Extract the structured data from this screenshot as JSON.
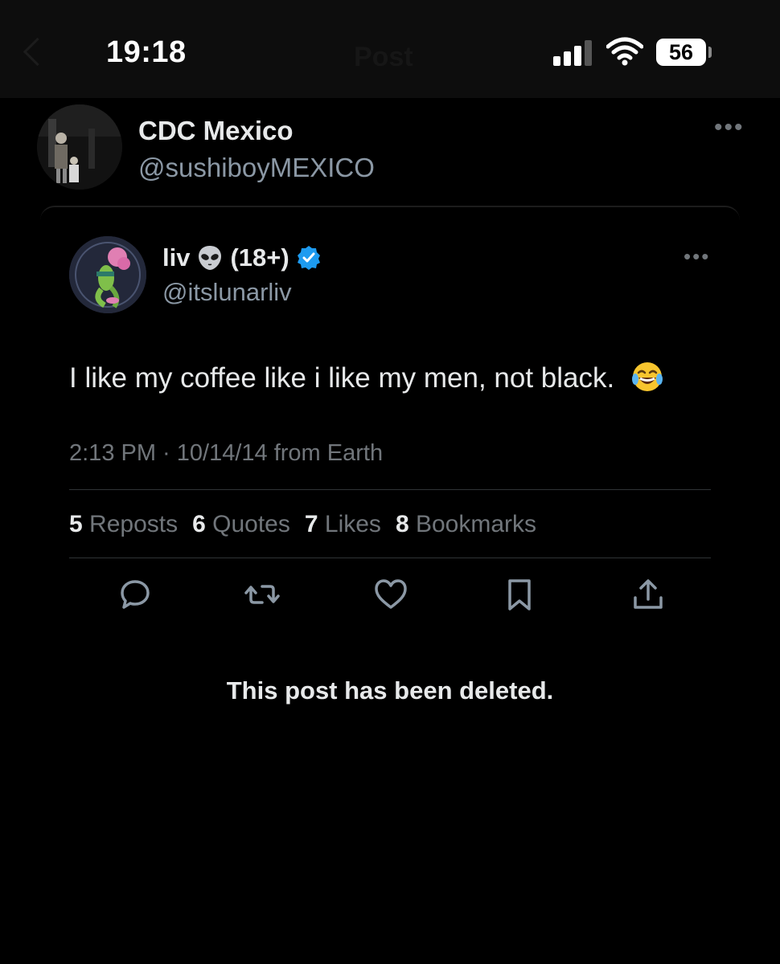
{
  "status_bar": {
    "time": "19:18",
    "battery": "56",
    "ghost_title": "Post"
  },
  "repost": {
    "display_name": "CDC Mexico",
    "handle": "@sushiboyMEXICO"
  },
  "quoted_post": {
    "display_name": "liv",
    "name_suffix": "(18+)",
    "handle": "@itslunarliv",
    "text": "I like my coffee like i like my men, not black.",
    "timestamp": "2:13 PM · 10/14/14 from Earth",
    "stats": {
      "reposts_count": "5",
      "reposts_label": "Reposts",
      "quotes_count": "6",
      "quotes_label": "Quotes",
      "likes_count": "7",
      "likes_label": "Likes",
      "bookmarks_count": "8",
      "bookmarks_label": "Bookmarks"
    },
    "icons": [
      "reply-icon",
      "repost-icon",
      "like-icon",
      "bookmark-icon",
      "share-icon"
    ],
    "verified_color": "#1d9bf0"
  },
  "deleted_notice": "This post has been deleted."
}
